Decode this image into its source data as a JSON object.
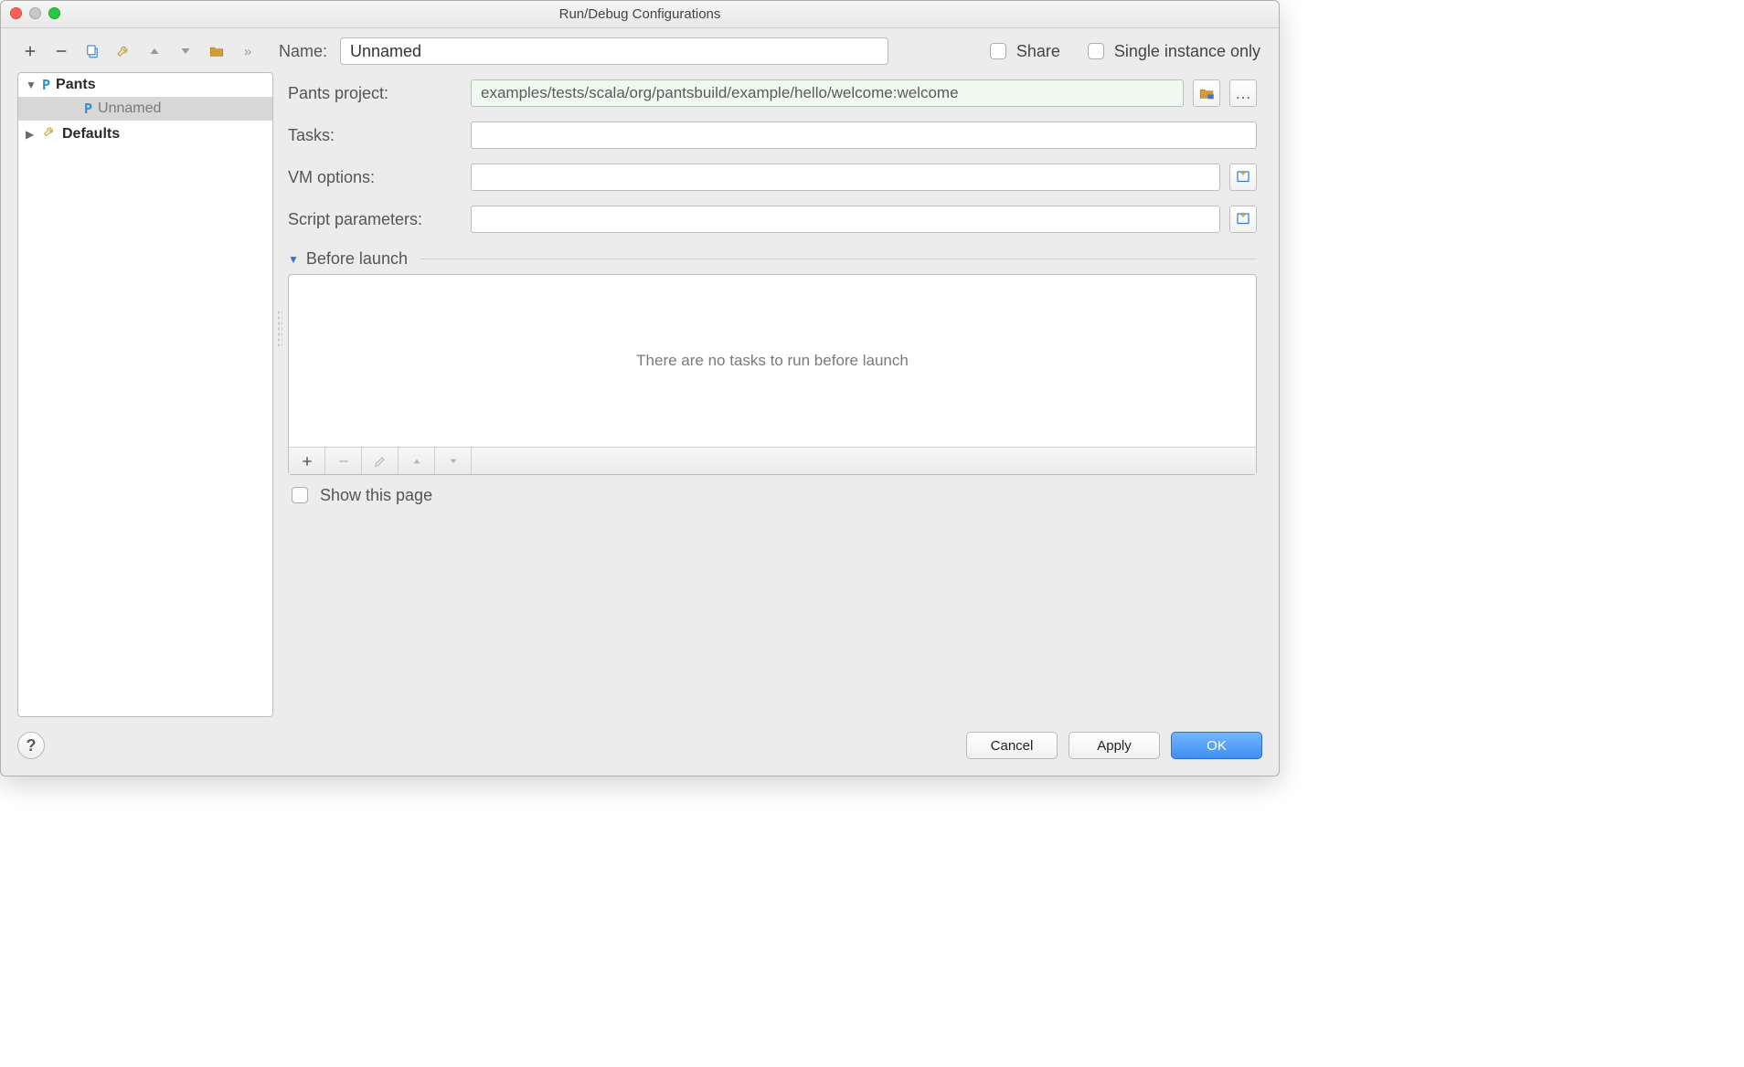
{
  "window": {
    "title": "Run/Debug Configurations"
  },
  "sidebar": {
    "items": [
      {
        "kind": "group",
        "label": "Pants",
        "expanded": true
      },
      {
        "kind": "config",
        "label": "Unnamed",
        "selected": true
      },
      {
        "kind": "group",
        "label": "Defaults",
        "expanded": false
      }
    ]
  },
  "name_field": {
    "label": "Name:",
    "value": "Unnamed"
  },
  "checkboxes": {
    "share": {
      "label": "Share",
      "checked": false
    },
    "single_instance": {
      "label": "Single instance only",
      "checked": false
    }
  },
  "form": {
    "pants_project": {
      "label": "Pants project:",
      "value": "examples/tests/scala/org/pantsbuild/example/hello/welcome:welcome"
    },
    "tasks": {
      "label": "Tasks:",
      "value": ""
    },
    "vm_options": {
      "label": "VM options:",
      "value": ""
    },
    "script_parameters": {
      "label": "Script parameters:",
      "value": ""
    }
  },
  "before_launch": {
    "header": "Before launch",
    "empty_text": "There are no tasks to run before launch"
  },
  "show_this_page": {
    "label": "Show this page",
    "checked": false
  },
  "footer": {
    "cancel": "Cancel",
    "apply": "Apply",
    "ok": "OK"
  }
}
